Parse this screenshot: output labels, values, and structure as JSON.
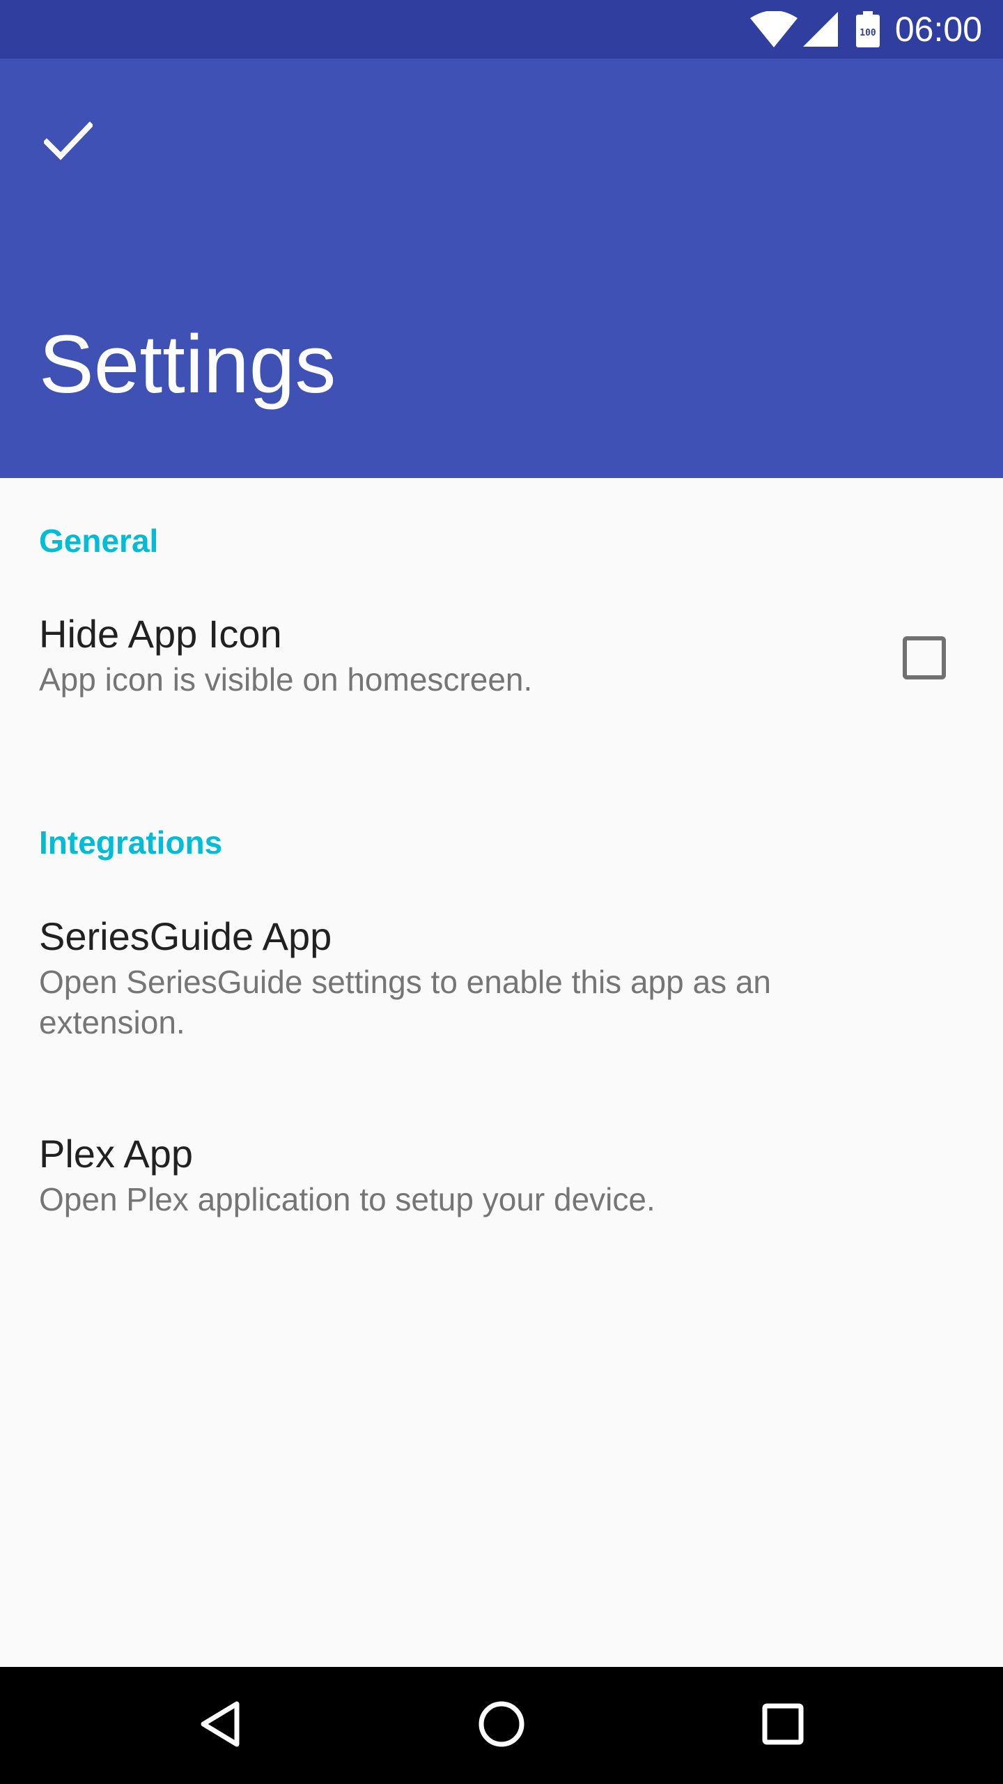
{
  "status_bar": {
    "time": "06:00",
    "battery_level": "100",
    "icons": [
      "wifi-icon",
      "cell-signal-icon",
      "battery-icon"
    ]
  },
  "app_bar": {
    "title": "Settings",
    "action_icon": "check-icon",
    "color": "#3f51b5",
    "status_color": "#303f9f"
  },
  "sections": [
    {
      "header": "General",
      "items": [
        {
          "title": "Hide App Icon",
          "summary": "App icon is visible on homescreen.",
          "checked": false
        }
      ]
    },
    {
      "header": "Integrations",
      "items": [
        {
          "title": "SeriesGuide App",
          "summary": "Open SeriesGuide settings to enable this app as an extension."
        },
        {
          "title": "Plex App",
          "summary": "Open Plex application to setup your device."
        }
      ]
    }
  ],
  "accent_color": "#00bcd4",
  "nav_bar": {
    "icons": [
      "back-icon",
      "home-icon",
      "recents-icon"
    ]
  }
}
